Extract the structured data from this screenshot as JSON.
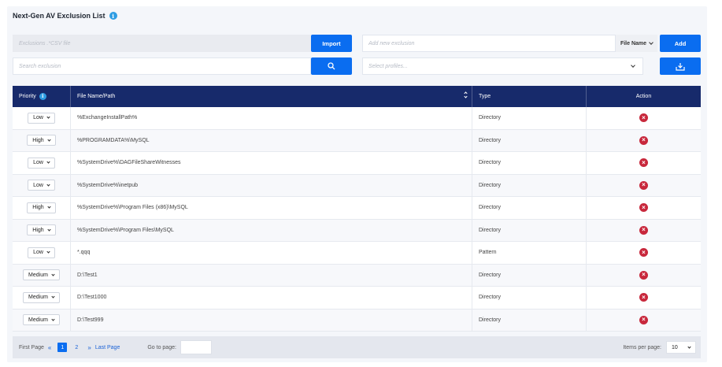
{
  "header": {
    "title": "Next-Gen AV Exclusion List"
  },
  "import_field": {
    "placeholder": "Exclusions .*CSV file"
  },
  "import_button": "Import",
  "new_exclusion": {
    "placeholder": "Add new exclusion"
  },
  "type_select": "File Name",
  "add_button": "Add",
  "search": {
    "placeholder": "Search exclusion"
  },
  "profiles": {
    "placeholder": "Select profiles..."
  },
  "table": {
    "headers": {
      "priority": "Priority",
      "path": "File Name/Path",
      "type": "Type",
      "action": "Action"
    },
    "rows": [
      {
        "priority": "Low",
        "path": "%ExchangeInstallPath%",
        "type": "Directory"
      },
      {
        "priority": "High",
        "path": "%PROGRAMDATA%\\MySQL",
        "type": "Directory"
      },
      {
        "priority": "Low",
        "path": "%SystemDrive%\\DAGFileShareWitnesses",
        "type": "Directory"
      },
      {
        "priority": "Low",
        "path": "%SystemDrive%\\inetpub",
        "type": "Directory"
      },
      {
        "priority": "High",
        "path": "%SystemDrive%\\Program Files (x86)\\MySQL",
        "type": "Directory"
      },
      {
        "priority": "High",
        "path": "%SystemDrive%\\Program Files\\MySQL",
        "type": "Directory"
      },
      {
        "priority": "Low",
        "path": "*.qqq",
        "type": "Pattern"
      },
      {
        "priority": "Medium",
        "path": "D:\\Test1",
        "type": "Directory"
      },
      {
        "priority": "Medium",
        "path": "D:\\Test1000",
        "type": "Directory"
      },
      {
        "priority": "Medium",
        "path": "D:\\Test999",
        "type": "Directory"
      }
    ]
  },
  "pager": {
    "first": "First Page",
    "pages": [
      "1",
      "2"
    ],
    "last": "Last Page",
    "goto_label": "Go to page:",
    "ipp_label": "Items per page:",
    "ipp_value": "10"
  },
  "colors": {
    "accent": "#0a6df0",
    "header_bg": "#172a6b",
    "delete": "#c8283c"
  },
  "icons": {
    "info": "info-icon",
    "search": "search-icon",
    "export": "download-icon",
    "delete": "delete-icon"
  }
}
